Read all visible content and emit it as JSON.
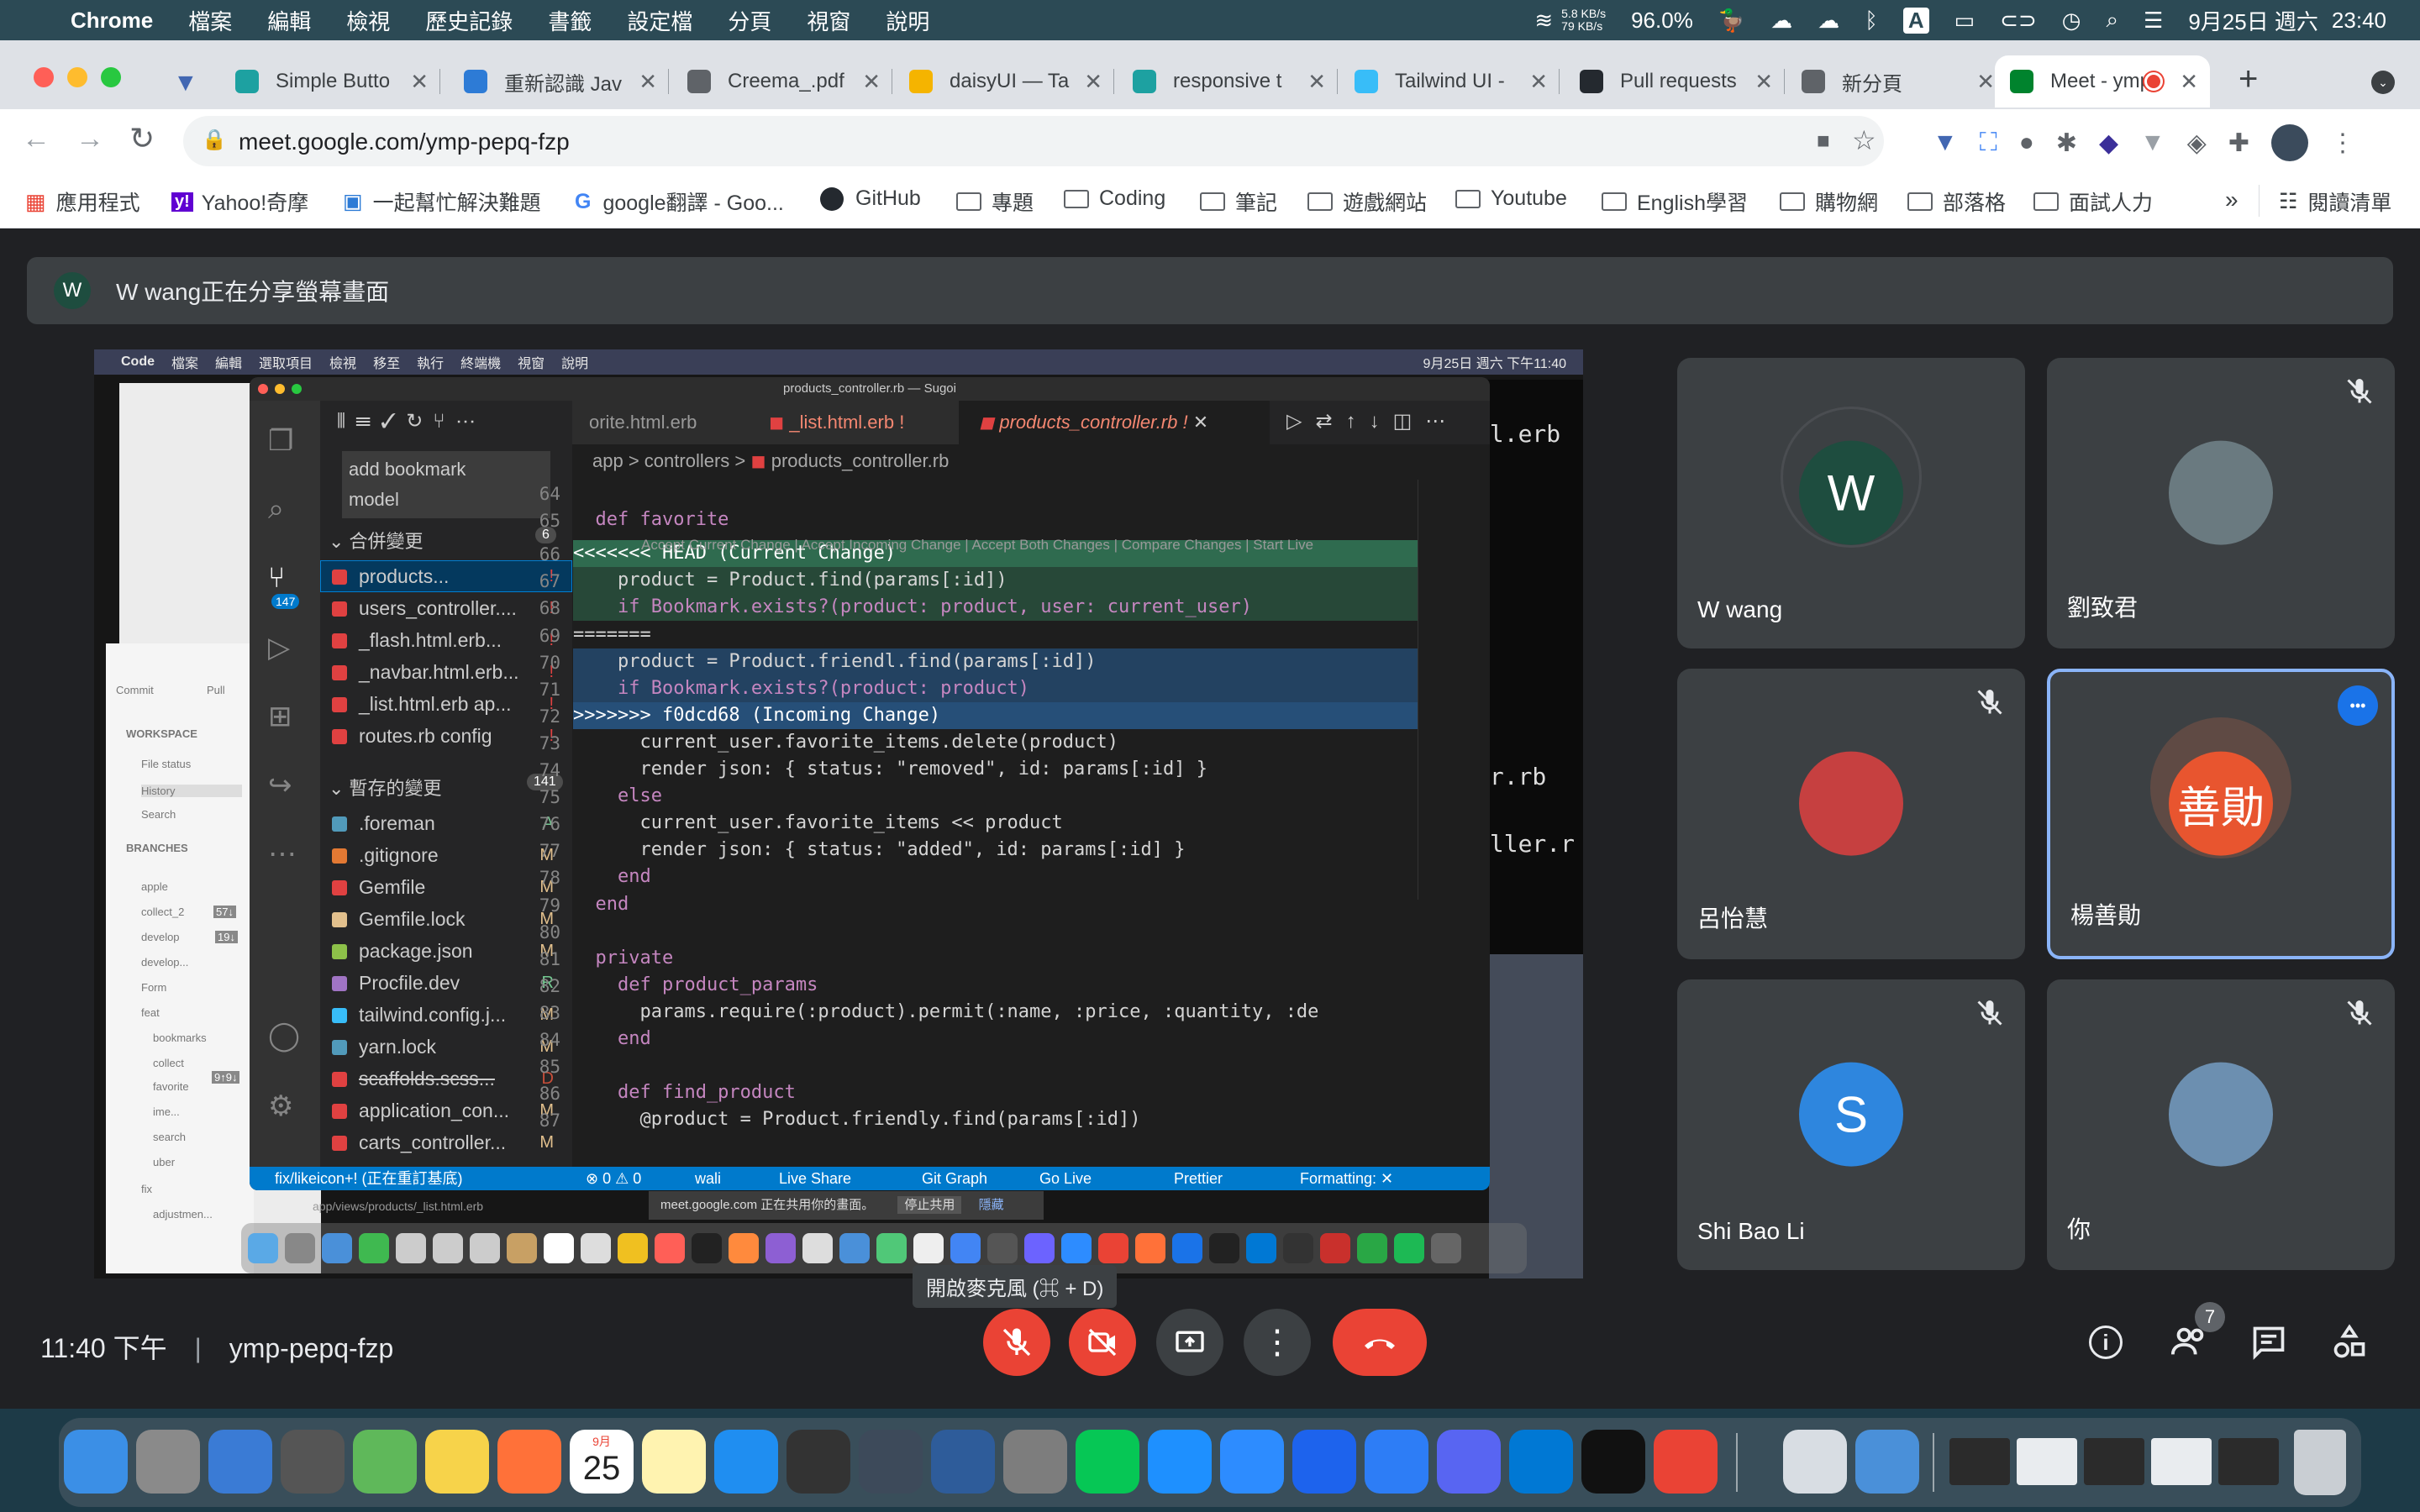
{
  "menubar": {
    "app": "Chrome",
    "menus": [
      "檔案",
      "編輯",
      "檢視",
      "歷史記錄",
      "書籤",
      "設定檔",
      "分頁",
      "視窗",
      "說明"
    ],
    "net_up": "5.8 KB/s",
    "net_down": "79 KB/s",
    "battery": "96.0%",
    "date": "9月25日 週六",
    "time": "23:40",
    "input_method": "A"
  },
  "tabs": [
    {
      "title": "Simple Butto",
      "favicon_color": "#1da1a1"
    },
    {
      "title": "重新認識 Jav",
      "favicon_color": "#2d7bd6"
    },
    {
      "title": "Creema_.pdf",
      "favicon_color": "#5f6368"
    },
    {
      "title": "daisyUI — Ta",
      "favicon_color": "#f5b400"
    },
    {
      "title": "responsive t",
      "favicon_color": "#1da1a1"
    },
    {
      "title": "Tailwind UI -",
      "favicon_color": "#38bdf8"
    },
    {
      "title": "Pull requests",
      "favicon_color": "#24292f"
    },
    {
      "title": "新分頁",
      "favicon_color": "#5f6368"
    },
    {
      "title": "Meet - ymp",
      "favicon_color": "#00832d",
      "active": true
    }
  ],
  "address": {
    "url": "meet.google.com/ymp-pepq-fzp"
  },
  "bookmarks": {
    "items": [
      "應用程式",
      "Yahoo!奇摩",
      "一起幫忙解決難題",
      "google翻譯 - Goo...",
      "GitHub",
      "專題",
      "Coding",
      "筆記",
      "遊戲網站",
      "Youtube",
      "English學習",
      "購物網",
      "部落格",
      "面試人力"
    ],
    "more": "»",
    "reading_list": "閱讀清單"
  },
  "meet": {
    "banner_avatar": "W",
    "banner_text": "W wang正在分享螢幕畫面",
    "meeting_time": "11:40 下午",
    "meeting_code": "ymp-pepq-fzp",
    "tooltip": "開啟麥克風 (⌘ + D)",
    "people_count": "7",
    "participants": [
      {
        "name": "W wang",
        "initial": "W",
        "color": "#1e4d3f",
        "muted": false
      },
      {
        "name": "劉致君",
        "initial": "",
        "color": "#6a7a80",
        "muted": true
      },
      {
        "name": "呂怡慧",
        "initial": "",
        "color": "#c64040",
        "muted": true
      },
      {
        "name": "楊善勛",
        "initial": "善勛",
        "color": "#e8552f",
        "muted": false
      },
      {
        "name": "Shi Bao Li",
        "initial": "S",
        "color": "#2e86de",
        "muted": true
      },
      {
        "name": "你",
        "initial": "",
        "color": "#6c8fb0",
        "muted": true
      }
    ]
  },
  "shared_screen": {
    "menubar": {
      "items": [
        "Code",
        "檔案",
        "編輯",
        "選取項目",
        "檢視",
        "移至",
        "執行",
        "終端機",
        "視窗",
        "說明"
      ],
      "datetime": "9月25日 週六 下午11:40"
    },
    "window_title": "products_controller.rb — Sugoi",
    "tabs": [
      "orite.html.erb",
      "_list.html.erb",
      "products_controller.rb"
    ],
    "tab_modified_marks": [
      "!",
      "!"
    ],
    "breadcrumb": [
      "app",
      "controllers",
      "products_controller.rb"
    ],
    "commit_message": "add bookmark\nmodel",
    "merge_section": {
      "label": "合併變更",
      "count": "6"
    },
    "staged_section": {
      "label": "暫存的變更",
      "count": "141"
    },
    "scm_badge": "147",
    "merge_files": [
      {
        "name": "products...",
        "status": "!"
      },
      {
        "name": "users_controller....",
        "status": "!"
      },
      {
        "name": "_flash.html.erb...",
        "status": "!"
      },
      {
        "name": "_navbar.html.erb...",
        "status": "!"
      },
      {
        "name": "_list.html.erb ap...",
        "status": "!"
      },
      {
        "name": "routes.rb config",
        "status": "!"
      }
    ],
    "staged_files": [
      {
        "name": ".foreman",
        "status": "A"
      },
      {
        "name": ".gitignore",
        "status": "M"
      },
      {
        "name": "Gemfile",
        "status": "M"
      },
      {
        "name": "Gemfile.lock",
        "status": "M"
      },
      {
        "name": "package.json",
        "status": "M"
      },
      {
        "name": "Procfile.dev",
        "status": "R"
      },
      {
        "name": "tailwind.config.j...",
        "status": "M"
      },
      {
        "name": "yarn.lock",
        "status": "M"
      },
      {
        "name": "scaffolds.scss...",
        "status": "D"
      },
      {
        "name": "application_con...",
        "status": "M"
      },
      {
        "name": "carts_controller...",
        "status": "M"
      }
    ],
    "codelens": "Accept Current Change | Accept Incoming Change | Accept Both Changes | Compare Changes | Start Live",
    "code_lines": [
      {
        "n": "64",
        "t": ""
      },
      {
        "n": "65",
        "t": "  def favorite"
      },
      {
        "n": "66",
        "t": "<<<<<<< HEAD (Current Change)"
      },
      {
        "n": "67",
        "t": "    product = Product.find(params[:id])"
      },
      {
        "n": "68",
        "t": "    if Bookmark.exists?(product: product, user: current_user)"
      },
      {
        "n": "69",
        "t": "======="
      },
      {
        "n": "70",
        "t": "    product = Product.friendl.find(params[:id])"
      },
      {
        "n": "71",
        "t": "    if Bookmark.exists?(product: product)"
      },
      {
        "n": "72",
        "t": ">>>>>>> f0dcd68 (Incoming Change)"
      },
      {
        "n": "73",
        "t": "      current_user.favorite_items.delete(product)"
      },
      {
        "n": "74",
        "t": "      render json: { status: \"removed\", id: params[:id] }"
      },
      {
        "n": "75",
        "t": "    else"
      },
      {
        "n": "76",
        "t": "      current_user.favorite_items << product"
      },
      {
        "n": "77",
        "t": "      render json: { status: \"added\", id: params[:id] }"
      },
      {
        "n": "78",
        "t": "    end"
      },
      {
        "n": "79",
        "t": "  end"
      },
      {
        "n": "80",
        "t": ""
      },
      {
        "n": "81",
        "t": "  private"
      },
      {
        "n": "82",
        "t": "    def product_params"
      },
      {
        "n": "83",
        "t": "      params.require(:product).permit(:name, :price, :quantity, :de"
      },
      {
        "n": "84",
        "t": "    end"
      },
      {
        "n": "85",
        "t": ""
      },
      {
        "n": "86",
        "t": "    def find_product"
      },
      {
        "n": "87",
        "t": "      @product = Product.friendly.find(params[:id])"
      }
    ],
    "status_bar": {
      "branch": "fix/likeicon+! (正在重訂基底)",
      "problems": "⊗ 0 ⚠ 0",
      "user": "wali",
      "live_share": "Live Share",
      "git_graph": "Git Graph",
      "go_live": "Go Live",
      "prettier": "Prettier",
      "formatting": "Formatting: ✕"
    },
    "share_notice": "meet.google.com 正在共用你的畫面。",
    "stop_share": "停止共用",
    "hide": "隱藏",
    "bg_terminal_lines": [
      "ml.erb",
      "er.rb",
      "oller.r"
    ],
    "bg_path": "app/views/products/_list.html.erb",
    "fork_panel": {
      "tabs": [
        "Commit",
        "Pull"
      ],
      "workspace": "WORKSPACE",
      "ws_items": [
        "File status",
        "History",
        "Search"
      ],
      "branches": "BRANCHES",
      "branch_items": [
        "apple",
        "collect_2",
        "develop",
        "develop...",
        "Form",
        "feat",
        "bookmarks",
        "collect",
        "favorite",
        "ime...",
        "search",
        "uber",
        "fix",
        "adjustmen..."
      ],
      "badges": [
        "57↓",
        "19↓",
        "9↑9↓"
      ]
    }
  },
  "dock": {
    "calendar_month": "9月",
    "calendar_day": "25",
    "apps": [
      "Finder",
      "Launchpad",
      "Mail",
      "Keychain",
      "Maps",
      "Photos",
      "Firefox",
      "Calendar",
      "Notes",
      "App Store",
      "Instruments",
      "QuickTime",
      "pgAdmin",
      "System Preferences",
      "LINE",
      "Safari",
      "Zoom",
      "Docker",
      "Maps Pin",
      "Discord",
      "VS Code",
      "Terminal",
      "Chrome",
      "Preview",
      "Keynote"
    ]
  },
  "colors": {
    "meet_bg": "#202124",
    "end_call": "#ea4335",
    "active_speaker_border": "#8ab4f8",
    "current_change": "#2f6b4f",
    "incoming_change": "#264f78"
  }
}
